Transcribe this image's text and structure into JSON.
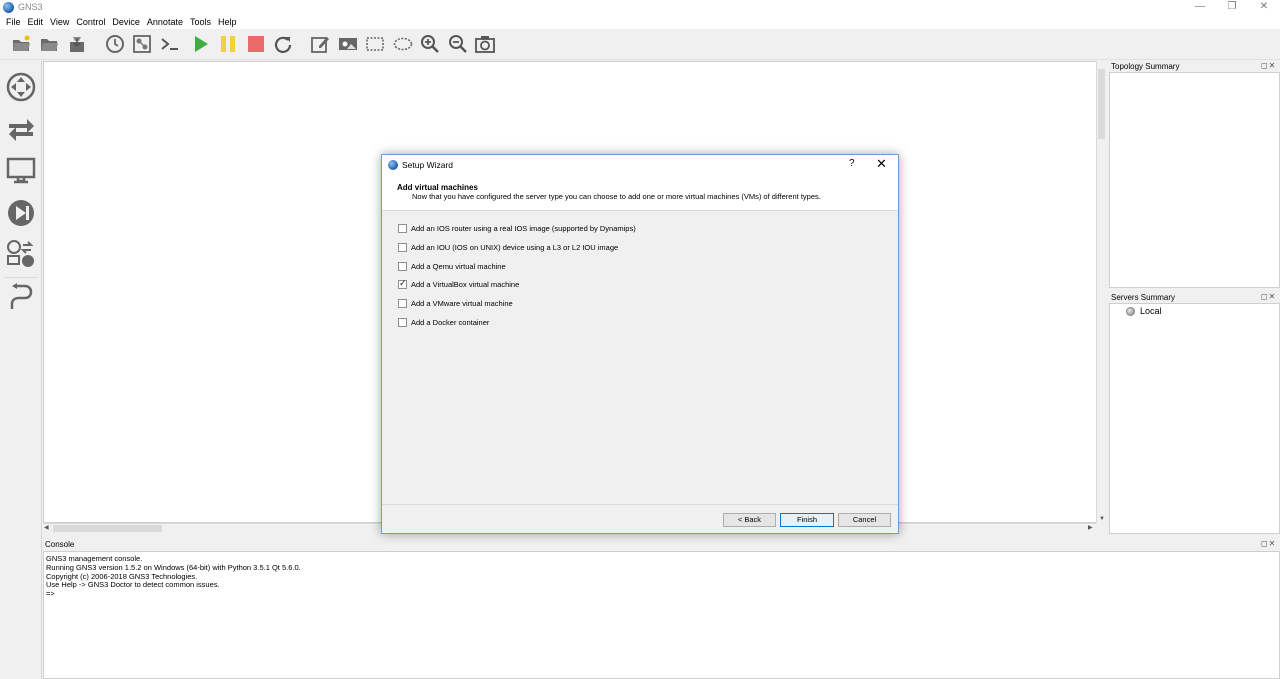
{
  "window": {
    "title": "GNS3",
    "controls": {
      "minimize": "—",
      "restore": "❐",
      "close": "✕"
    }
  },
  "menu": [
    "File",
    "Edit",
    "View",
    "Control",
    "Device",
    "Annotate",
    "Tools",
    "Help"
  ],
  "toolbar": {
    "icons": [
      "new-project-icon",
      "open-project-icon",
      "save-project-icon",
      "snapshot-icon",
      "show-interface-labels-icon",
      "console-all-icon",
      "start-all-icon",
      "suspend-all-icon",
      "stop-all-icon",
      "reload-all-icon",
      "add-note-icon",
      "insert-image-icon",
      "draw-rectangle-icon",
      "draw-ellipse-icon",
      "zoom-in-icon",
      "zoom-out-icon",
      "screenshot-icon"
    ],
    "colors": {
      "start": "#3fae3f",
      "suspend": "#f2d23a",
      "stop": "#e86a6a"
    }
  },
  "devices": [
    "routers-icon",
    "switches-icon",
    "end-devices-icon",
    "security-devices-icon",
    "all-devices-icon",
    "add-link-icon"
  ],
  "topology_summary": {
    "title": "Topology Summary"
  },
  "servers_summary": {
    "title": "Servers Summary",
    "servers": [
      {
        "name": "Local",
        "status_color": "#9a9a9a"
      }
    ]
  },
  "dock_buttons": "◻✕",
  "console": {
    "title": "Console",
    "lines": [
      "GNS3 management console.",
      "Running GNS3 version 1.5.2 on Windows (64-bit) with Python 3.5.1 Qt 5.6.0.",
      "Copyright (c) 2006-2018 GNS3 Technologies.",
      "Use Help -> GNS3 Doctor to detect common issues.",
      "",
      "=>"
    ]
  },
  "dialog": {
    "title": "Setup Wizard",
    "help": "?",
    "close": "✕",
    "heading": "Add virtual machines",
    "subheading": "Now that you have configured the server type you can choose to add one or more virtual machines (VMs) of different types.",
    "options": [
      {
        "label": "Add an IOS router using a real IOS image (supported by Dynamips)",
        "checked": false
      },
      {
        "label": "Add an IOU (IOS on UNIX) device using a L3 or L2 IOU image",
        "checked": false
      },
      {
        "label": "Add a Qemu virtual machine",
        "checked": false
      },
      {
        "label": "Add a VirtualBox virtual machine",
        "checked": true
      },
      {
        "label": "Add a VMware virtual machine",
        "checked": false
      },
      {
        "label": "Add a Docker container",
        "checked": false
      }
    ],
    "buttons": {
      "back": "< Back",
      "finish": "Finish",
      "cancel": "Cancel"
    }
  },
  "scroll_arrows": {
    "left": "◀",
    "right": "▶",
    "up": "▲",
    "down": "▼"
  }
}
